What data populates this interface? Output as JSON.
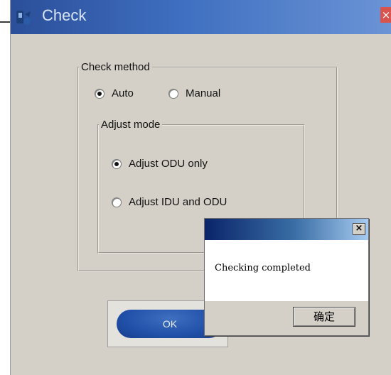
{
  "window": {
    "title": "Check",
    "close_glyph": "×"
  },
  "check_method": {
    "legend": "Check method",
    "options": [
      {
        "label": "Auto",
        "selected": true
      },
      {
        "label": "Manual",
        "selected": false
      }
    ]
  },
  "adjust_mode": {
    "legend": "Adjust mode",
    "options": [
      {
        "label": "Adjust ODU only",
        "selected": true
      },
      {
        "label": "Adjust IDU and ODU",
        "selected": false
      }
    ]
  },
  "ok_button": {
    "label": "OK"
  },
  "message_box": {
    "close_glyph": "×",
    "text": "Checking completed",
    "confirm_label": "确定"
  },
  "colors": {
    "title_bar": "#3f6fc0",
    "dialog_bg": "#d4d0c8",
    "ok_button": "#2050a8",
    "close_button": "#d9534f"
  },
  "icons": [
    "app-icon",
    "close-icon",
    "message-close-icon"
  ]
}
